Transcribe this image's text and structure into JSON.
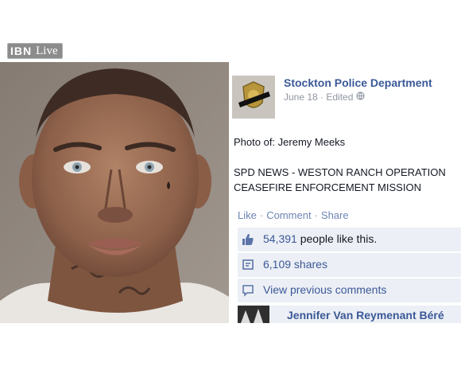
{
  "watermark": {
    "brand": "IBN",
    "suffix": "Live"
  },
  "post": {
    "page_name": "Stockton Police Department",
    "date": "June 18",
    "edited": "· Edited",
    "photo_of": "Photo of: Jeremy Meeks",
    "news_line_1": "SPD NEWS - WESTON RANCH OPERATION",
    "news_line_2": "CEASEFIRE ENFORCEMENT MISSION",
    "actions": {
      "like": "Like",
      "comment": "Comment",
      "share": "Share",
      "separator": "·"
    },
    "likes": {
      "count": "54,391",
      "suffix": "people like this."
    },
    "shares": {
      "label": "6,109 shares"
    },
    "view_comments": "View previous comments",
    "comment": {
      "author": "Jennifer Van Reymenant",
      "author_cutoff": "Béré"
    }
  },
  "colors": {
    "link": "#3b5998",
    "ufi_bg": "#eceff5",
    "meta": "#9197a3"
  },
  "icons": [
    "thumbs-up-icon",
    "share-icon",
    "comment-icon",
    "globe-icon"
  ]
}
